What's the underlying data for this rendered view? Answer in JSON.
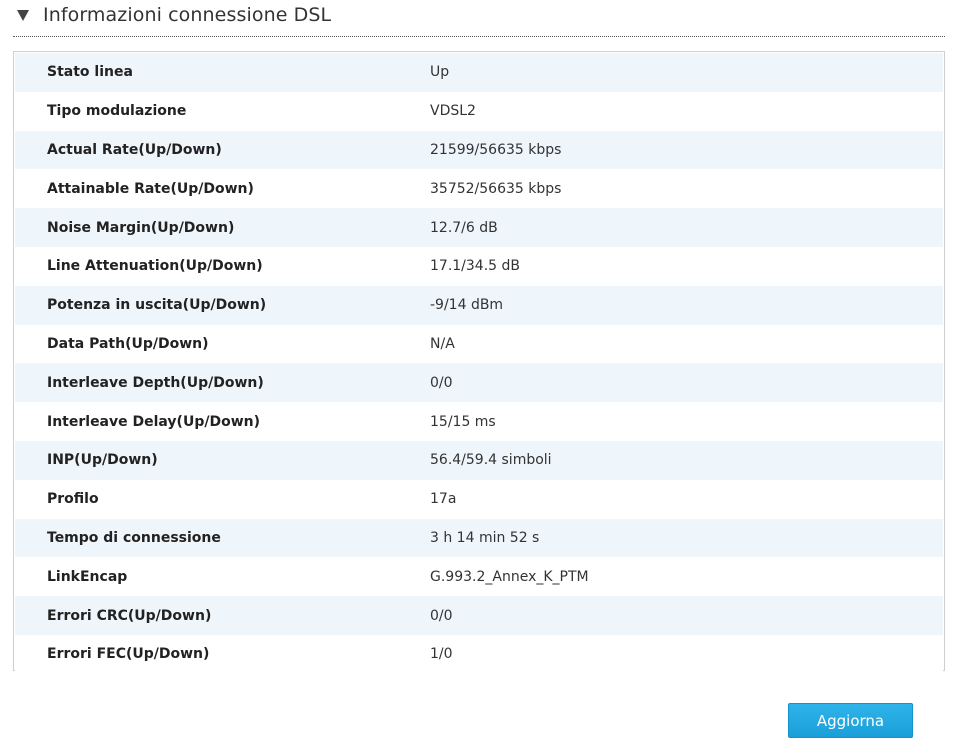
{
  "section": {
    "title": "Informazioni connessione DSL",
    "toggle_icon": "triangle-down-icon"
  },
  "rows": [
    {
      "label": "Stato linea",
      "value": "Up"
    },
    {
      "label": "Tipo modulazione",
      "value": "VDSL2"
    },
    {
      "label": "Actual Rate(Up/Down)",
      "value": "21599/56635 kbps"
    },
    {
      "label": "Attainable Rate(Up/Down)",
      "value": "35752/56635 kbps"
    },
    {
      "label": "Noise Margin(Up/Down)",
      "value": "12.7/6 dB"
    },
    {
      "label": "Line Attenuation(Up/Down)",
      "value": "17.1/34.5 dB"
    },
    {
      "label": "Potenza in uscita(Up/Down)",
      "value": "-9/14 dBm"
    },
    {
      "label": "Data Path(Up/Down)",
      "value": "N/A"
    },
    {
      "label": "Interleave Depth(Up/Down)",
      "value": "0/0"
    },
    {
      "label": "Interleave Delay(Up/Down)",
      "value": "15/15 ms"
    },
    {
      "label": "INP(Up/Down)",
      "value": "56.4/59.4 simboli"
    },
    {
      "label": "Profilo",
      "value": "17a"
    },
    {
      "label": "Tempo di connessione",
      "value": "3 h 14 min 52 s"
    },
    {
      "label": "LinkEncap",
      "value": "G.993.2_Annex_K_PTM"
    },
    {
      "label": "Errori CRC(Up/Down)",
      "value": "0/0"
    },
    {
      "label": "Errori FEC(Up/Down)",
      "value": "1/0"
    }
  ],
  "actions": {
    "refresh_label": "Aggiorna"
  },
  "colors": {
    "row_alt_bg": "#eef5fb",
    "button_bg": "#1a9fd9"
  }
}
